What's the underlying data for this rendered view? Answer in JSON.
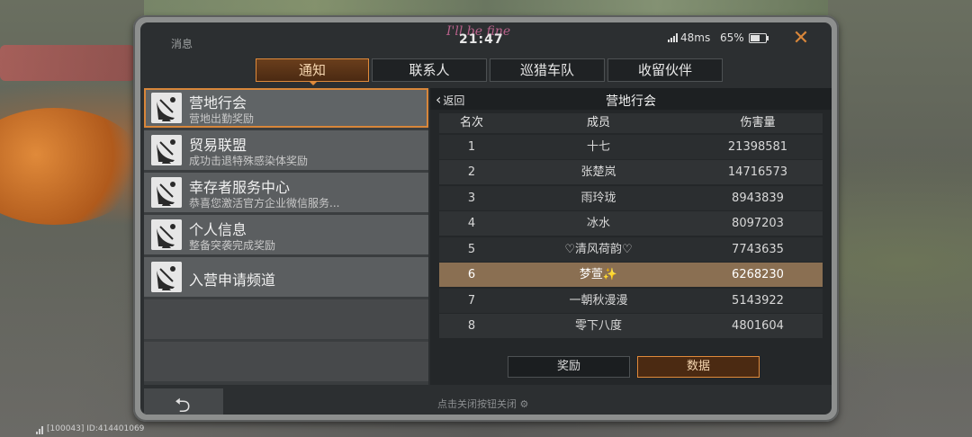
{
  "status": {
    "title": "消息",
    "time": "21:47",
    "song": "I'll be fine",
    "ping": "48ms",
    "battery_percent": "65%",
    "battery_level": 0.65
  },
  "tabs": [
    {
      "label": "通知",
      "active": true
    },
    {
      "label": "联系人",
      "active": false
    },
    {
      "label": "巡猎车队",
      "active": false
    },
    {
      "label": "收留伙伴",
      "active": false
    }
  ],
  "messages": [
    {
      "title": "营地行会",
      "subtitle": "营地出勤奖励",
      "icon": "satellite-dish-icon"
    },
    {
      "title": "贸易联盟",
      "subtitle": "成功击退特殊感染体奖励",
      "icon": "satellite-dish-icon"
    },
    {
      "title": "幸存者服务中心",
      "subtitle": "恭喜您激活官方企业微信服务...",
      "icon": "satellite-dish-icon"
    },
    {
      "title": "个人信息",
      "subtitle": "整备突袭完成奖励",
      "icon": "satellite-dish-icon"
    },
    {
      "title": "入营申请频道",
      "subtitle": "",
      "icon": "satellite-dish-icon"
    }
  ],
  "detail": {
    "back_label": "返回",
    "title": "营地行会",
    "columns": {
      "rank": "名次",
      "member": "成员",
      "damage": "伤害量"
    },
    "rows": [
      {
        "rank": "1",
        "member": "十七",
        "damage": "21398581"
      },
      {
        "rank": "2",
        "member": "张楚岚",
        "damage": "14716573"
      },
      {
        "rank": "3",
        "member": "雨玲珑",
        "damage": "8943839"
      },
      {
        "rank": "4",
        "member": "冰水",
        "damage": "8097203"
      },
      {
        "rank": "5",
        "member": "♡清风荷韵♡",
        "damage": "7743635"
      },
      {
        "rank": "6",
        "member": "梦萱✨",
        "damage": "6268230"
      },
      {
        "rank": "7",
        "member": "一朝秋漫漫",
        "damage": "5143922"
      },
      {
        "rank": "8",
        "member": "零下八度",
        "damage": "4801604"
      }
    ],
    "highlight_rank": "6",
    "buttons": {
      "reward": "奖励",
      "data": "数据"
    }
  },
  "footer": {
    "hint": "点击关闭按钮关闭 ⚙",
    "server_id": "[100043] ID:414401069"
  },
  "colors": {
    "accent": "#e08a3a",
    "highlight_row": "#8a6f52"
  }
}
